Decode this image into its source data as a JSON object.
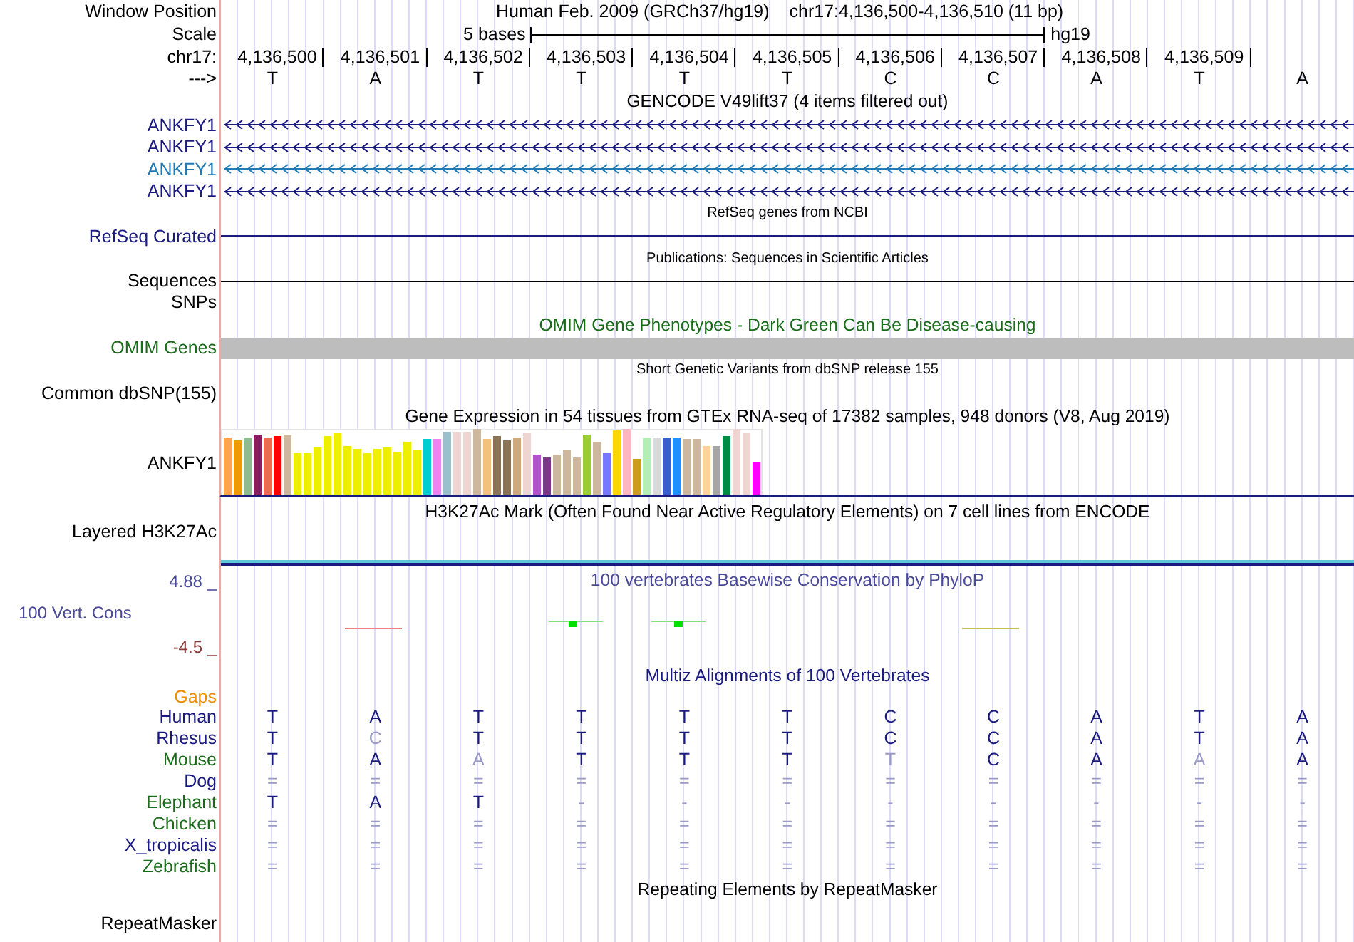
{
  "header": {
    "position_label": "Window Position",
    "assembly": "Human Feb. 2009 (GRCh37/hg19)",
    "position": "chr17:4,136,500-4,136,510 (11 bp)",
    "scale_label": "Scale",
    "scale_text": "5 bases",
    "scale_assembly": "hg19",
    "chrom_label": "chr17:",
    "positions": [
      "4,136,500",
      "4,136,501",
      "4,136,502",
      "4,136,503",
      "4,136,504",
      "4,136,505",
      "4,136,506",
      "4,136,507",
      "4,136,508",
      "4,136,509"
    ],
    "strand_label": "--->",
    "bases": [
      "T",
      "A",
      "T",
      "T",
      "T",
      "T",
      "C",
      "C",
      "A",
      "T",
      "A"
    ]
  },
  "tracks": [
    {
      "kind": "gene",
      "title": "GENCODE V49lift37 (4 items filtered out)",
      "items": [
        {
          "label": "ANKFY1",
          "color": "#1a1a80"
        },
        {
          "label": "ANKFY1",
          "color": "#1a1a80"
        },
        {
          "label": "ANKFY1",
          "color": "#1f7ab5"
        },
        {
          "label": "ANKFY1",
          "color": "#1a1a80"
        }
      ]
    },
    {
      "kind": "line",
      "title": "RefSeq genes from NCBI",
      "label": "RefSeq Curated",
      "color": "#1a1a80"
    },
    {
      "kind": "line",
      "title": "Publications: Sequences in Scientific Articles",
      "label": "Sequences",
      "color": "#000000"
    },
    {
      "kind": "label",
      "label": "SNPs",
      "color": "#000000"
    },
    {
      "kind": "bar",
      "title": "OMIM Gene Phenotypes - Dark Green Can Be Disease-causing",
      "label": "OMIM Genes",
      "color": "#1a6b1a"
    },
    {
      "kind": "snp",
      "title": "Short Genetic Variants from dbSNP release 155",
      "label": "Common dbSNP(155)",
      "color": "#000000"
    },
    {
      "kind": "expression",
      "title": "Gene Expression in 54 tissues from GTEx RNA-seq of 17382 samples, 948 donors (V8, Aug 2019)",
      "label": "ANKFY1",
      "color": "#000000"
    },
    {
      "kind": "signal",
      "title": "H3K27Ac Mark (Often Found Near Active Regulatory Elements) on 7 cell lines from ENCODE",
      "label": "Layered H3K27Ac",
      "color": "#000000"
    },
    {
      "kind": "wiggle",
      "title": "100 vertebrates Basewise Conservation by PhyloP",
      "label": "100 Vert. Cons",
      "color": "#4a4a9a",
      "max": "4.88 _",
      "min": "-4.5 _"
    },
    {
      "kind": "alignment",
      "title": "Multiz Alignments of 100 Vertebrates",
      "gaps_label": "Gaps",
      "species": [
        {
          "label": "Human",
          "color": "#1a1a80",
          "bases": [
            {
              "base": "T",
              "faint": false
            },
            {
              "base": "A",
              "faint": false
            },
            {
              "base": "T",
              "faint": false
            },
            {
              "base": "T",
              "faint": false
            },
            {
              "base": "T",
              "faint": false
            },
            {
              "base": "T",
              "faint": false
            },
            {
              "base": "C",
              "faint": false
            },
            {
              "base": "C",
              "faint": false
            },
            {
              "base": "A",
              "faint": false
            },
            {
              "base": "T",
              "faint": false
            },
            {
              "base": "A",
              "faint": false
            }
          ]
        },
        {
          "label": "Rhesus",
          "color": "#1a1a80",
          "bases": [
            {
              "base": "T",
              "faint": false
            },
            {
              "base": "C",
              "faint": true
            },
            {
              "base": "T",
              "faint": false
            },
            {
              "base": "T",
              "faint": false
            },
            {
              "base": "T",
              "faint": false
            },
            {
              "base": "T",
              "faint": false
            },
            {
              "base": "C",
              "faint": false
            },
            {
              "base": "C",
              "faint": false
            },
            {
              "base": "A",
              "faint": false
            },
            {
              "base": "T",
              "faint": false
            },
            {
              "base": "A",
              "faint": false
            }
          ]
        },
        {
          "label": "Mouse",
          "color": "#1a6b1a",
          "bases": [
            {
              "base": "T",
              "faint": false
            },
            {
              "base": "A",
              "faint": false
            },
            {
              "base": "A",
              "faint": true
            },
            {
              "base": "T",
              "faint": false
            },
            {
              "base": "T",
              "faint": false
            },
            {
              "base": "T",
              "faint": false
            },
            {
              "base": "T",
              "faint": true
            },
            {
              "base": "C",
              "faint": false
            },
            {
              "base": "A",
              "faint": false
            },
            {
              "base": "A",
              "faint": true
            },
            {
              "base": "A",
              "faint": false
            }
          ]
        },
        {
          "label": "Dog",
          "color": "#1a1a80",
          "bases": [
            {
              "base": "=",
              "faint": true
            },
            {
              "base": "=",
              "faint": true
            },
            {
              "base": "=",
              "faint": true
            },
            {
              "base": "=",
              "faint": true
            },
            {
              "base": "=",
              "faint": true
            },
            {
              "base": "=",
              "faint": true
            },
            {
              "base": "=",
              "faint": true
            },
            {
              "base": "=",
              "faint": true
            },
            {
              "base": "=",
              "faint": true
            },
            {
              "base": "=",
              "faint": true
            },
            {
              "base": "=",
              "faint": true
            }
          ]
        },
        {
          "label": "Elephant",
          "color": "#1a6b1a",
          "bases": [
            {
              "base": "T",
              "faint": false
            },
            {
              "base": "A",
              "faint": false
            },
            {
              "base": "T",
              "faint": false
            },
            {
              "base": "-",
              "faint": true
            },
            {
              "base": "-",
              "faint": true
            },
            {
              "base": "-",
              "faint": true
            },
            {
              "base": "-",
              "faint": true
            },
            {
              "base": "-",
              "faint": true
            },
            {
              "base": "-",
              "faint": true
            },
            {
              "base": "-",
              "faint": true
            },
            {
              "base": "-",
              "faint": true
            }
          ]
        },
        {
          "label": "Chicken",
          "color": "#1a6b1a",
          "bases": [
            {
              "base": "=",
              "faint": true
            },
            {
              "base": "=",
              "faint": true
            },
            {
              "base": "=",
              "faint": true
            },
            {
              "base": "=",
              "faint": true
            },
            {
              "base": "=",
              "faint": true
            },
            {
              "base": "=",
              "faint": true
            },
            {
              "base": "=",
              "faint": true
            },
            {
              "base": "=",
              "faint": true
            },
            {
              "base": "=",
              "faint": true
            },
            {
              "base": "=",
              "faint": true
            },
            {
              "base": "=",
              "faint": true
            }
          ]
        },
        {
          "label": "X_tropicalis",
          "color": "#1a1a80",
          "bases": [
            {
              "base": "=",
              "faint": true
            },
            {
              "base": "=",
              "faint": true
            },
            {
              "base": "=",
              "faint": true
            },
            {
              "base": "=",
              "faint": true
            },
            {
              "base": "=",
              "faint": true
            },
            {
              "base": "=",
              "faint": true
            },
            {
              "base": "=",
              "faint": true
            },
            {
              "base": "=",
              "faint": true
            },
            {
              "base": "=",
              "faint": true
            },
            {
              "base": "=",
              "faint": true
            },
            {
              "base": "=",
              "faint": true
            }
          ]
        },
        {
          "label": "Zebrafish",
          "color": "#1a6b1a",
          "bases": [
            {
              "base": "=",
              "faint": true
            },
            {
              "base": "=",
              "faint": true
            },
            {
              "base": "=",
              "faint": true
            },
            {
              "base": "=",
              "faint": true
            },
            {
              "base": "=",
              "faint": true
            },
            {
              "base": "=",
              "faint": true
            },
            {
              "base": "=",
              "faint": true
            },
            {
              "base": "=",
              "faint": true
            },
            {
              "base": "=",
              "faint": true
            },
            {
              "base": "=",
              "faint": true
            },
            {
              "base": "=",
              "faint": true
            }
          ]
        }
      ]
    },
    {
      "kind": "repeat",
      "title": "Repeating Elements by RepeatMasker",
      "label": "RepeatMasker",
      "color": "#000000"
    }
  ]
}
